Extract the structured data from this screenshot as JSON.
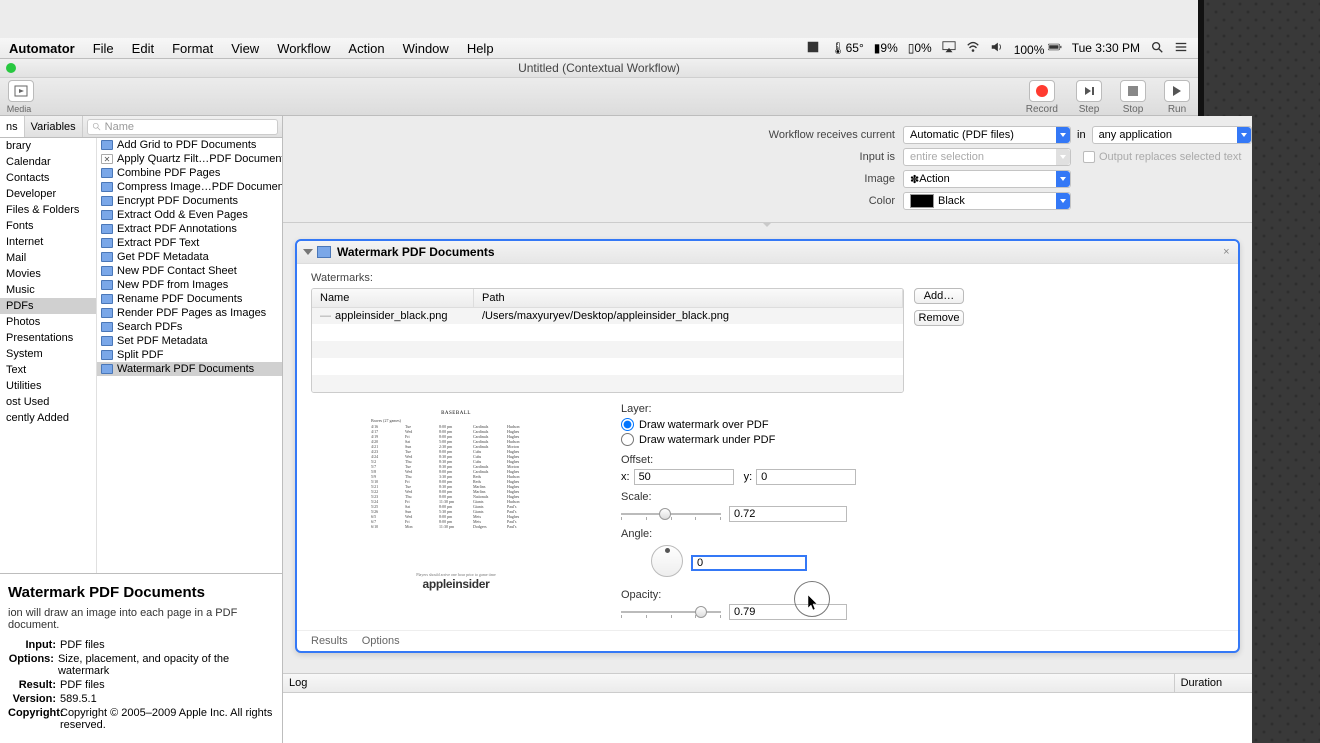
{
  "menubar": {
    "app": "Automator",
    "items": [
      "File",
      "Edit",
      "Format",
      "View",
      "Workflow",
      "Action",
      "Window",
      "Help"
    ],
    "temp": "65°",
    "battery1": "9%",
    "battery2": "0%",
    "battery3": "100%",
    "clock": "Tue 3:30 PM"
  },
  "window": {
    "title": "Untitled (Contextual Workflow)"
  },
  "toolbar": {
    "media": "Media",
    "buttons": {
      "record": "Record",
      "step": "Step",
      "stop": "Stop",
      "run": "Run"
    }
  },
  "library": {
    "tabs": {
      "actions_suffix": "ns",
      "variables": "Variables"
    },
    "search_placeholder": "Name",
    "categories": [
      "brary",
      "Calendar",
      "Contacts",
      "Developer",
      "Files & Folders",
      "Fonts",
      "Internet",
      "Mail",
      "Movies",
      "Music",
      "PDFs",
      "Photos",
      "Presentations",
      "System",
      "Text",
      "Utilities",
      "ost Used",
      "cently Added"
    ],
    "selected_category": "PDFs",
    "actions": [
      "Add Grid to PDF Documents",
      "Apply Quartz Filt…PDF Documents",
      "Combine PDF Pages",
      "Compress Image…PDF Documents",
      "Encrypt PDF Documents",
      "Extract Odd & Even Pages",
      "Extract PDF Annotations",
      "Extract PDF Text",
      "Get PDF Metadata",
      "New PDF Contact Sheet",
      "New PDF from Images",
      "Rename PDF Documents",
      "Render PDF Pages as Images",
      "Search PDFs",
      "Set PDF Metadata",
      "Split PDF",
      "Watermark PDF Documents"
    ],
    "selected_action": "Watermark PDF Documents"
  },
  "description": {
    "title": "Watermark PDF Documents",
    "summary": "ion will draw an image into each page in a PDF document.",
    "input_label": "Input:",
    "input": "PDF files",
    "options_label": "Options:",
    "options": "Size, placement, and opacity of the watermark",
    "result_label": "Result:",
    "result": "PDF files",
    "version_label": "Version:",
    "version": "589.5.1",
    "copyright_label": "Copyright:",
    "copyright": "Copyright © 2005–2009 Apple Inc.  All rights reserved."
  },
  "workflow_opts": {
    "receives_label": "Workflow receives current",
    "receives_value": "Automatic (PDF files)",
    "in_label": "in",
    "in_value": "any application",
    "input_is_label": "Input is",
    "input_is_value": "entire selection",
    "replaces_label": "Output replaces selected text",
    "image_label": "Image",
    "image_value": "Action",
    "color_label": "Color",
    "color_value": "Black"
  },
  "card": {
    "title": "Watermark PDF Documents",
    "watermarks_label": "Watermarks:",
    "columns": {
      "name": "Name",
      "path": "Path"
    },
    "rows": [
      {
        "name": "appleinsider_black.png",
        "path": "/Users/maxyuryev/Desktop/appleinsider_black.png"
      }
    ],
    "add": "Add…",
    "remove": "Remove",
    "layer_label": "Layer:",
    "layer_over": "Draw watermark over PDF",
    "layer_under": "Draw watermark under PDF",
    "offset_label": "Offset:",
    "x_label": "x:",
    "x_value": "50",
    "y_label": "y:",
    "y_value": "0",
    "scale_label": "Scale:",
    "scale_value": "0.72",
    "angle_label": "Angle:",
    "angle_value": "0",
    "opacity_label": "Opacity:",
    "opacity_value": "0.79",
    "results": "Results",
    "options": "Options"
  },
  "preview": {
    "heading": "BASEBALL",
    "subheading": "Braves (27 games)",
    "rows": [
      [
        "4/16",
        "Tue",
        "8:00 pm",
        "Cardinals",
        "Hudson"
      ],
      [
        "4/17",
        "Wed",
        "8:00 pm",
        "Cardinals",
        "Hughes"
      ],
      [
        "4/19",
        "Fri",
        "8:00 pm",
        "Cardinals",
        "Hughes"
      ],
      [
        "4/20",
        "Sat",
        "5:00 pm",
        "Cardinals",
        "Hudson"
      ],
      [
        "4/21",
        "Sun",
        "2:30 pm",
        "Cardinals",
        "Morton"
      ],
      [
        "4/23",
        "Tue",
        "8:00 pm",
        "Cubs",
        "Hughes"
      ],
      [
        "4/24",
        "Wed",
        "8:30 pm",
        "Cubs",
        "Hughes"
      ],
      [
        "5/2",
        "Thu",
        "8:30 pm",
        "Cubs",
        "Hughes"
      ],
      [
        "5/7",
        "Tue",
        "8:30 pm",
        "Cardinals",
        "Morton"
      ],
      [
        "5/8",
        "Wed",
        "8:00 pm",
        "Cardinals",
        "Hughes"
      ],
      [
        "5/9",
        "Thu",
        "3:30 pm",
        "Reds",
        "Hudson"
      ],
      [
        "5/10",
        "Fri",
        "8:00 pm",
        "Reds",
        "Hughes"
      ],
      [
        "5/21",
        "Tue",
        "8:30 pm",
        "Marlins",
        "Hughes"
      ],
      [
        "5/22",
        "Wed",
        "8:00 pm",
        "Marlins",
        "Hughes"
      ],
      [
        "5/23",
        "Thu",
        "8:00 pm",
        "Nationals",
        "Hughes"
      ],
      [
        "5/24",
        "Fri",
        "11:30 pm",
        "Giants",
        "Hudson"
      ],
      [
        "5/25",
        "Sat",
        "8:00 pm",
        "Giants",
        "Paul's"
      ],
      [
        "5/26",
        "Sun",
        "5:30 pm",
        "Giants",
        "Paul's"
      ],
      [
        "6/5",
        "Wed",
        "8:00 pm",
        "Mets",
        "Hughes"
      ],
      [
        "6/7",
        "Fri",
        "8:00 pm",
        "Mets",
        "Paul's"
      ],
      [
        "6/10",
        "Mon",
        "11:30 pm",
        "Dodgers",
        "Paul's"
      ]
    ],
    "footer": "Players should arrive one hour prior to game time",
    "watermark": "appleinsider"
  },
  "log": {
    "left": "Log",
    "right": "Duration"
  }
}
